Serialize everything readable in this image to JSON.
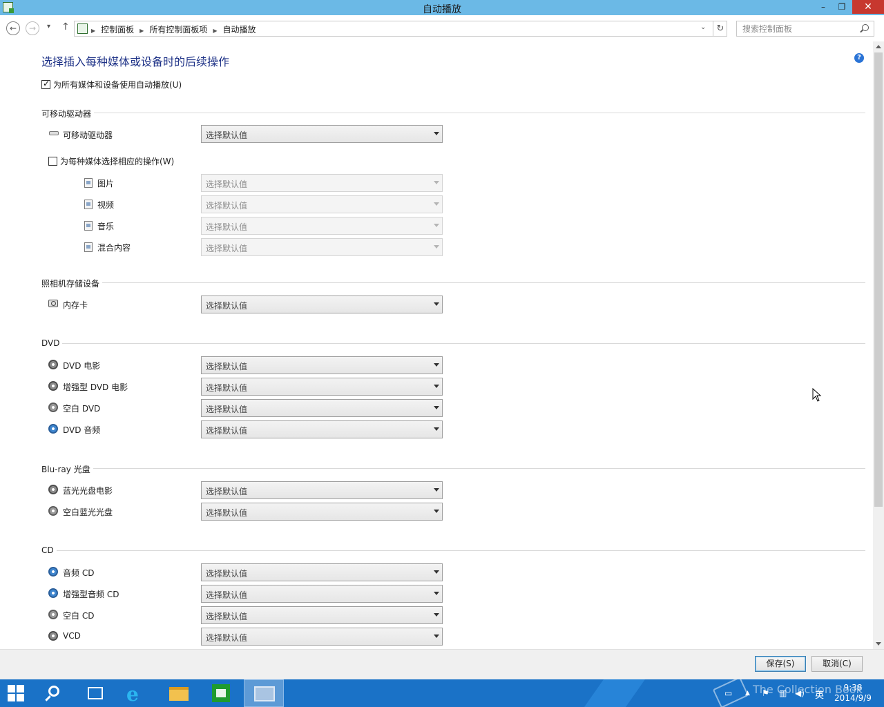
{
  "window": {
    "title": "自动播放",
    "min_glyph": "–",
    "max_glyph": "❐",
    "close_glyph": "✕"
  },
  "nav": {
    "back_glyph": "←",
    "forward_glyph": "→",
    "recent_glyph": "▾",
    "up_glyph": "↑",
    "breadcrumb": [
      "控制面板",
      "所有控制面板项",
      "自动播放"
    ],
    "breadcrumb_sep": "▶",
    "dropdown_glyph": "⌄",
    "refresh_glyph": "↻",
    "search_placeholder": "搜索控制面板"
  },
  "main": {
    "title": "选择插入每种媒体或设备时的后续操作",
    "help_glyph": "?",
    "use_autoplay": {
      "label": "为所有媒体和设备使用自动播放(U)",
      "checked": true
    },
    "sections": {
      "removable": {
        "label": "可移动驱动器",
        "drive": {
          "label": "可移动驱动器",
          "value": "选择默认值",
          "icon": "removable-drive-icon"
        },
        "per_media": {
          "label": "为每种媒体选择相应的操作(W)",
          "checked": false
        },
        "media": [
          {
            "label": "图片",
            "value": "选择默认值",
            "icon": "picture-file-icon"
          },
          {
            "label": "视频",
            "value": "选择默认值",
            "icon": "video-file-icon"
          },
          {
            "label": "音乐",
            "value": "选择默认值",
            "icon": "music-file-icon"
          },
          {
            "label": "混合内容",
            "value": "选择默认值",
            "icon": "mixed-content-icon"
          }
        ]
      },
      "camera": {
        "label": "照相机存储设备",
        "items": [
          {
            "label": "内存卡",
            "value": "选择默认值",
            "icon": "memory-card-icon"
          }
        ]
      },
      "dvd": {
        "label": "DVD",
        "items": [
          {
            "label": "DVD 电影",
            "value": "选择默认值",
            "icon": "dvd-movie-icon"
          },
          {
            "label": "增强型 DVD 电影",
            "value": "选择默认值",
            "icon": "enhanced-dvd-icon"
          },
          {
            "label": "空白 DVD",
            "value": "选择默认值",
            "icon": "blank-dvd-icon"
          },
          {
            "label": "DVD 音频",
            "value": "选择默认值",
            "icon": "dvd-audio-icon"
          }
        ]
      },
      "bluray": {
        "label": "Blu-ray 光盘",
        "items": [
          {
            "label": "蓝光光盘电影",
            "value": "选择默认值",
            "icon": "bluray-movie-icon"
          },
          {
            "label": "空白蓝光光盘",
            "value": "选择默认值",
            "icon": "blank-bluray-icon"
          }
        ]
      },
      "cd": {
        "label": "CD",
        "items": [
          {
            "label": "音频 CD",
            "value": "选择默认值",
            "icon": "audio-cd-icon"
          },
          {
            "label": "增强型音频 CD",
            "value": "选择默认值",
            "icon": "enhanced-audio-cd-icon"
          },
          {
            "label": "空白 CD",
            "value": "选择默认值",
            "icon": "blank-cd-icon"
          },
          {
            "label": "VCD",
            "value": "选择默认值",
            "icon": "vcd-icon"
          }
        ]
      }
    }
  },
  "buttons": {
    "save": "保存(S)",
    "cancel": "取消(C)"
  },
  "taskbar": {
    "ime": "英",
    "time": "9:38",
    "date": "2014/9/9",
    "watermark": "The Collection Book",
    "tray_up_glyph": "▲",
    "flag_glyph": "⚑",
    "network_glyph": "▥",
    "volume_glyph": "◀)",
    "keyboard_glyph": "▭"
  },
  "colors": {
    "titlebar": "#6bb9e6",
    "close_button": "#c7382f",
    "page_title": "#1e3287",
    "taskbar": "#1a72c7",
    "help_icon": "#2b74d6"
  }
}
